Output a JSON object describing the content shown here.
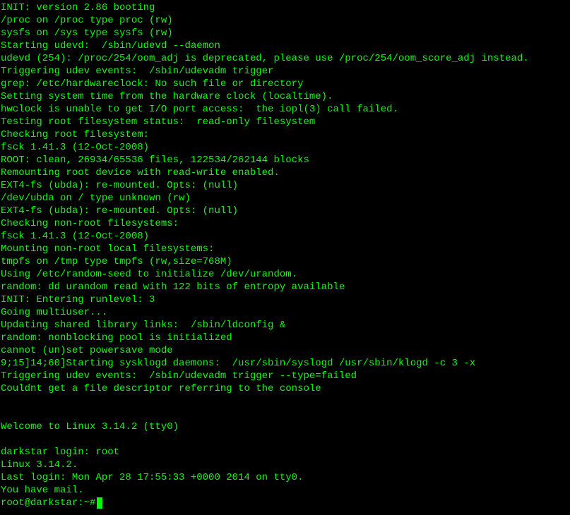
{
  "lines": [
    "INIT: version 2.86 booting",
    "/proc on /proc type proc (rw)",
    "sysfs on /sys type sysfs (rw)",
    "Starting udevd:  /sbin/udevd --daemon",
    "udevd (254): /proc/254/oom_adj is deprecated, please use /proc/254/oom_score_adj instead.",
    "Triggering udev events:  /sbin/udevadm trigger",
    "grep: /etc/hardwareclock: No such file or directory",
    "Setting system time from the hardware clock (localtime).",
    "hwclock is unable to get I/O port access:  the iopl(3) call failed.",
    "Testing root filesystem status:  read-only filesystem",
    "Checking root filesystem:",
    "fsck 1.41.3 (12-Oct-2008)",
    "ROOT: clean, 26934/65536 files, 122534/262144 blocks",
    "Remounting root device with read-write enabled.",
    "EXT4-fs (ubda): re-mounted. Opts: (null)",
    "/dev/ubda on / type unknown (rw)",
    "EXT4-fs (ubda): re-mounted. Opts: (null)",
    "Checking non-root filesystems:",
    "fsck 1.41.3 (12-Oct-2008)",
    "Mounting non-root local filesystems:",
    "tmpfs on /tmp type tmpfs (rw,size=768M)",
    "Using /etc/random-seed to initialize /dev/urandom.",
    "random: dd urandom read with 122 bits of entropy available",
    "INIT: Entering runlevel: 3",
    "Going multiuser...",
    "Updating shared library links:  /sbin/ldconfig &",
    "random: nonblocking pool is initialized",
    "cannot (un)set powersave mode",
    "\u001b9;15]\u001b14;60]Starting sysklogd daemons:  /usr/sbin/syslogd /usr/sbin/klogd -c 3 -x",
    "Triggering udev events:  /sbin/udevadm trigger --type=failed",
    "Couldnt get a file descriptor referring to the console",
    "",
    "",
    "Welcome to Linux 3.14.2 (tty0)",
    "",
    "darkstar login: root",
    "Linux 3.14.2.",
    "Last login: Mon Apr 28 17:55:33 +0000 2014 on tty0.",
    "You have mail."
  ],
  "prompt": "root@darkstar:~# "
}
